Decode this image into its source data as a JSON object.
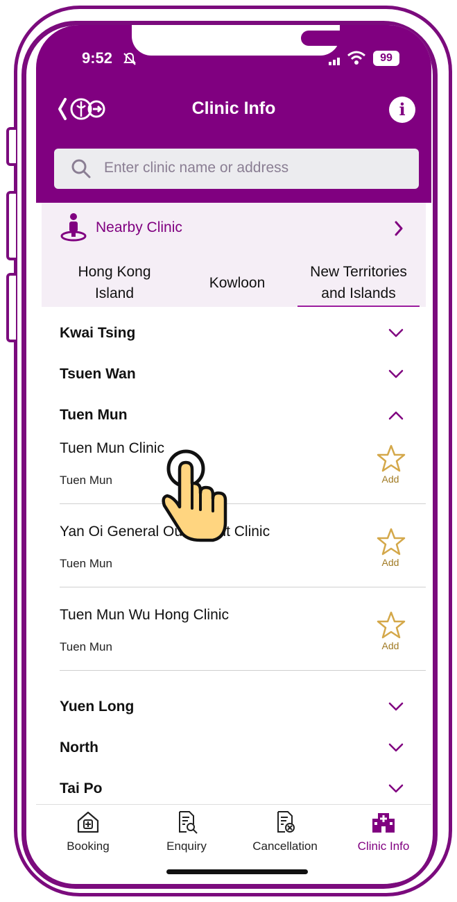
{
  "status": {
    "time": "9:52",
    "battery": "99"
  },
  "header": {
    "title": "Clinic Info"
  },
  "search": {
    "placeholder": "Enter clinic name or address"
  },
  "nearby": {
    "label": "Nearby Clinic"
  },
  "tabs": [
    {
      "label_line1": "Hong Kong",
      "label_line2": "Island"
    },
    {
      "label_line1": "Kowloon"
    },
    {
      "label_line1": "New Territories",
      "label_line2": "and Islands",
      "active": true
    }
  ],
  "regions": {
    "kwai_tsing": "Kwai Tsing",
    "tsuen_wan": "Tsuen Wan",
    "tuen_mun": "Tuen Mun",
    "yuen_long": "Yuen Long",
    "north": "North",
    "tai_po": "Tai Po"
  },
  "clinics": [
    {
      "name": "Tuen Mun Clinic",
      "district": "Tuen Mun",
      "add_label": "Add"
    },
    {
      "name": "Yan Oi General Outpatient Clinic",
      "district": "Tuen Mun",
      "add_label": "Add"
    },
    {
      "name": "Tuen Mun Wu Hong Clinic",
      "district": "Tuen Mun",
      "add_label": "Add"
    }
  ],
  "tabbar": {
    "booking": "Booking",
    "enquiry": "Enquiry",
    "cancellation": "Cancellation",
    "clinic_info": "Clinic Info"
  },
  "colors": {
    "brand": "#800080",
    "star": "#d4a84a",
    "background_tint": "#f5eef6"
  }
}
